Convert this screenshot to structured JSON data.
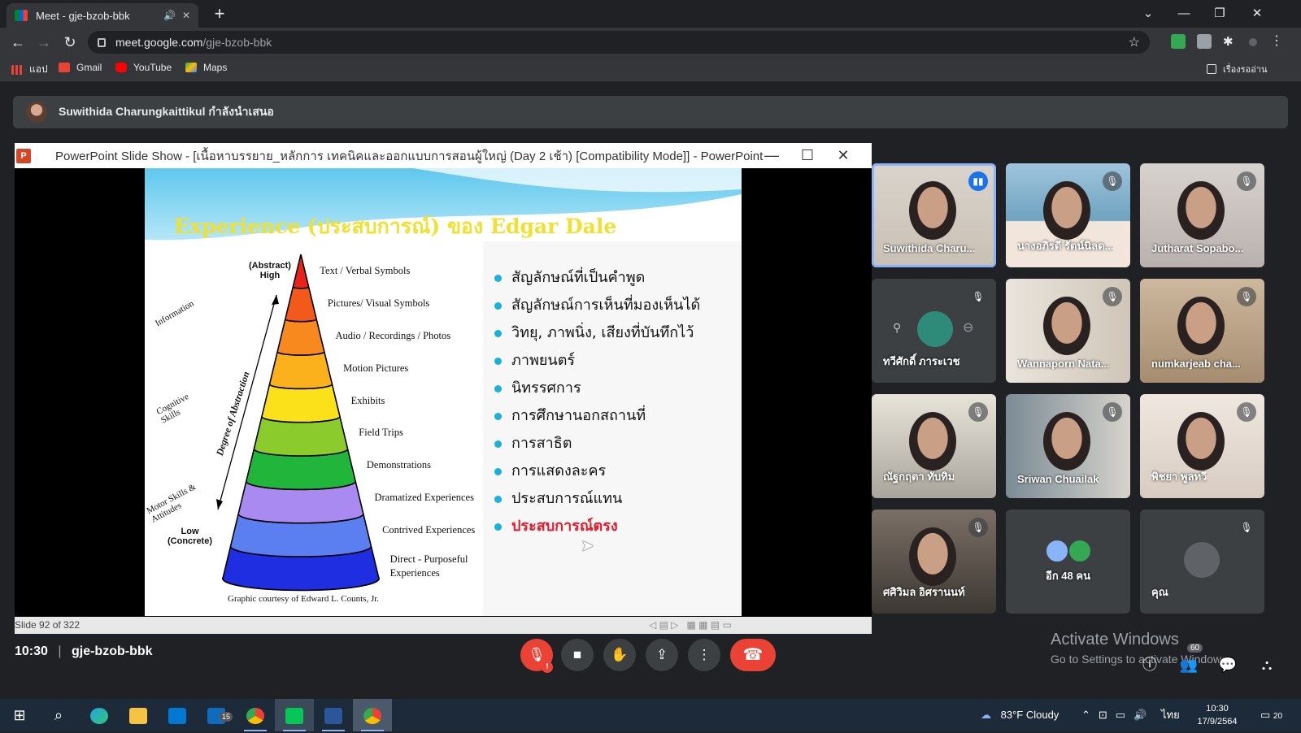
{
  "browser": {
    "tab_title": "Meet - gje-bzob-bbk",
    "tab_audio_icon": "speaker-icon",
    "url_host": "meet.google.com",
    "url_path": "/gje-bzob-bbk",
    "bookmarks": [
      {
        "label": "แอป",
        "icon": "apps-grid-icon"
      },
      {
        "label": "Gmail",
        "icon": "gmail-icon"
      },
      {
        "label": "YouTube",
        "icon": "youtube-icon"
      },
      {
        "label": "Maps",
        "icon": "maps-icon"
      }
    ],
    "reading_list": "เรื่องรออ่าน"
  },
  "meet": {
    "presenting_banner": "Suwithida Charungkaittikul กำลังนำเสนอ",
    "meeting_time": "10:30",
    "meeting_code": "gje-bzob-bbk",
    "people_count": "60",
    "participants": [
      {
        "name": "Suwithida Charu...",
        "speaking": true
      },
      {
        "name": "นางอภิรดี รัตน์นิลด...",
        "speaking": false
      },
      {
        "name": "Jutharat Sopabo...",
        "speaking": false
      },
      {
        "name": "ทวีศักดิ์ ภาระเวช",
        "speaking": false
      },
      {
        "name": "Wannaporn Nata...",
        "speaking": false
      },
      {
        "name": "numkarjeab cha...",
        "speaking": false
      },
      {
        "name": "ณัฐกฤตา ทับทิม",
        "speaking": false
      },
      {
        "name": "Sriwan Chuailak",
        "speaking": false
      },
      {
        "name": "พิชยา พูลทวี",
        "speaking": false
      },
      {
        "name": "ศศิวิมล อิศรานนท์",
        "speaking": false
      },
      {
        "name": "อีก 48 คน",
        "speaking": false
      },
      {
        "name": "คุณ",
        "speaking": false
      }
    ],
    "activate_title": "Activate Windows",
    "activate_sub": "Go to Settings to activate Windows."
  },
  "ppt": {
    "window_title": "PowerPoint Slide Show - [เนื้อหาบรรยาย_หลักการ เทคนิคและออกแบบการสอนผู้ใหญ่ (Day 2 เช้า) [Compatibility Mode]] - PowerPoint",
    "status": "Slide 92 of 322",
    "slide": {
      "title": "Experience (ประสบการณ์) ของ Edgar Dale",
      "top_label": "(Abstract)\nHigh",
      "bottom_label": "Low\n(Concrete)",
      "axis_label": "Degree of Abstraction",
      "side_labels": [
        "Information",
        "Cognitive Skills",
        "Motor Skills & Attitudes"
      ],
      "levels": [
        {
          "label": "Text / Verbal Symbols",
          "color": "#e8231c"
        },
        {
          "label": "Pictures/ Visual Symbols",
          "color": "#f25a1c"
        },
        {
          "label": "Audio / Recordings / Photos",
          "color": "#f7891e"
        },
        {
          "label": "Motion Pictures",
          "color": "#fbb11c"
        },
        {
          "label": "Exhibits",
          "color": "#fbe11a"
        },
        {
          "label": "Field Trips",
          "color": "#8ccb2c"
        },
        {
          "label": "Demonstrations",
          "color": "#22b53c"
        },
        {
          "label": "Dramatized Experiences",
          "color": "#a98af0"
        },
        {
          "label": "Contrived Experiences",
          "color": "#5b7ef0"
        },
        {
          "label": "Direct - Purposeful Experiences",
          "color": "#1f2ee0"
        }
      ],
      "credit": "Graphic courtesy of Edward L. Counts, Jr.",
      "bullets": [
        "สัญลักษณ์ที่เป็นคำพูด",
        "สัญลักษณ์การเห็นที่มองเห็นได้",
        "วิทยุ, ภาพนิ่ง, เสียงที่บันทึกไว้",
        "ภาพยนตร์",
        "นิทรรศการ",
        "การศึกษานอกสถานที่",
        "การสาธิต",
        "การแสดงละคร",
        "ประสบการณ์แทน",
        "ประสบการณ์ตรง"
      ]
    }
  },
  "taskbar": {
    "weather": "83°F  Cloudy",
    "lang": "ไทย",
    "clock_time": "10:30",
    "clock_date": "17/9/2564",
    "mail_badge": "15",
    "notif_count": "20"
  }
}
